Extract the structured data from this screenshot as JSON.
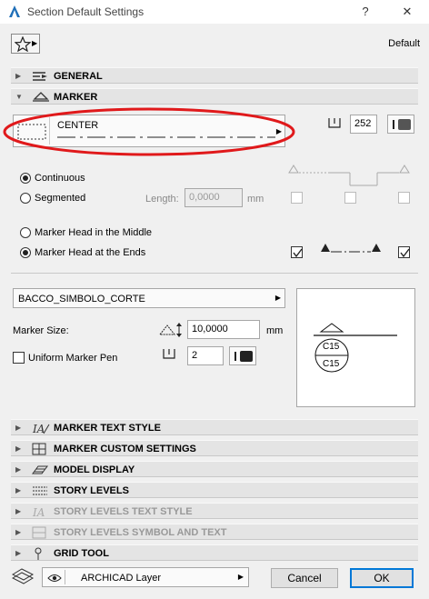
{
  "window": {
    "title": "Section Default Settings",
    "help": "?",
    "close": "✕"
  },
  "toolbar": {
    "favorites_label": "Default"
  },
  "sections": {
    "general": "GENERAL",
    "marker": "MARKER",
    "marker_text_style": "MARKER TEXT STYLE",
    "marker_custom_settings": "MARKER CUSTOM SETTINGS",
    "model_display": "MODEL DISPLAY",
    "story_levels": "STORY LEVELS",
    "story_levels_text_style": "STORY LEVELS TEXT STYLE",
    "story_levels_symbol_and_text": "STORY LEVELS SYMBOL AND TEXT",
    "grid_tool": "GRID TOOL"
  },
  "marker": {
    "line_type_name": "CENTER",
    "pen_number": "252",
    "continuous_label": "Continuous",
    "segmented_label": "Segmented",
    "length_label": "Length:",
    "length_value": "0,0000",
    "length_unit": "mm",
    "head_middle_label": "Marker Head in the Middle",
    "head_ends_label": "Marker Head at the Ends",
    "symbol_name": "BACCO_SIMBOLO_CORTE",
    "size_label": "Marker Size:",
    "size_value": "10,0000",
    "size_unit": "mm",
    "uniform_pen_label": "Uniform Marker Pen",
    "uniform_pen_value": "2",
    "preview_text_top": "C15",
    "preview_text_bottom": "C15"
  },
  "footer": {
    "layer_name": "ARCHICAD Layer",
    "cancel_label": "Cancel",
    "ok_label": "OK"
  },
  "colors": {
    "accent": "#0078d7",
    "annotation_red": "#e0191b"
  }
}
